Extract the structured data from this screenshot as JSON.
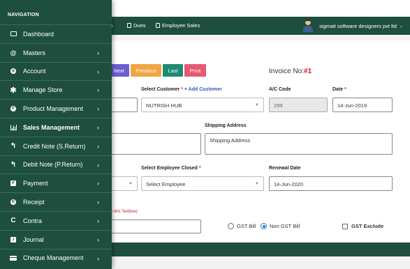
{
  "sidebar": {
    "title": "NAVIGATION",
    "items": [
      {
        "label": "Dashboard",
        "icon": "monitor-icon",
        "chevron": false
      },
      {
        "label": "Masters",
        "icon": "at-icon",
        "chevron": true
      },
      {
        "label": "Account",
        "icon": "account-circle-icon",
        "chevron": true
      },
      {
        "label": "Manage Store",
        "icon": "asterisk-icon",
        "chevron": true
      },
      {
        "label": "Product Management",
        "icon": "product-circle-icon",
        "chevron": true
      },
      {
        "label": "Sales Management",
        "icon": "bar-chart-icon",
        "chevron": true
      },
      {
        "label": "Credit Note (S.Return)",
        "icon": "return-arrow-icon",
        "chevron": true
      },
      {
        "label": "Debit Note (P.Return)",
        "icon": "return-arrow-icon",
        "chevron": true
      },
      {
        "label": "Payment",
        "icon": "payment-box-icon",
        "chevron": true
      },
      {
        "label": "Receipt",
        "icon": "receipt-circle-icon",
        "chevron": true
      },
      {
        "label": "Contra",
        "icon": "contra-c-icon",
        "chevron": true
      },
      {
        "label": "Journal",
        "icon": "journal-icon",
        "chevron": true
      },
      {
        "label": "Cheque Management",
        "icon": "card-icon",
        "chevron": true
      }
    ],
    "chevron_glyph": "›"
  },
  "navbar": {
    "link_partial": "n",
    "dues": "Dues",
    "employee_sales": "Employee Sales",
    "company": "sigmait software designers pvt ltd",
    "caret": "⌄"
  },
  "toolbar": {
    "next": "Next",
    "previous": "Previous",
    "last": "Last",
    "print": "Print"
  },
  "invoice": {
    "label": "Invoice No:",
    "number": "#1"
  },
  "form": {
    "select_customer_label": "Select Customer",
    "required_mark": "*",
    "add_customer": "+ Add Customer",
    "customer_value": "NUTRISH HUB",
    "ac_code_label": "A/C Code",
    "ac_code_value": "299",
    "date_label": "Date",
    "date_value": "14-Jun-2019",
    "shipping_label": "Shipping Address",
    "shipping_placeholder": "Shipping Address",
    "employee_label": "Select Employee Closed",
    "employee_value": "Select Employee",
    "renewal_label": "Renewal Date",
    "renewal_value": "14-Jun-2020",
    "hint_partial": "on this Textbox)",
    "gst_bill": "GST Bill",
    "non_gst_bill": "Non GST Bill",
    "gst_exclude": "GST Exclude"
  },
  "colors": {
    "nav_green": "#1e4f3e",
    "next": "#6c5fd3",
    "previous": "#f0a642",
    "last": "#1e8a72",
    "print": "#e55a6f",
    "required": "#d0142c",
    "link": "#2b5bb8"
  }
}
